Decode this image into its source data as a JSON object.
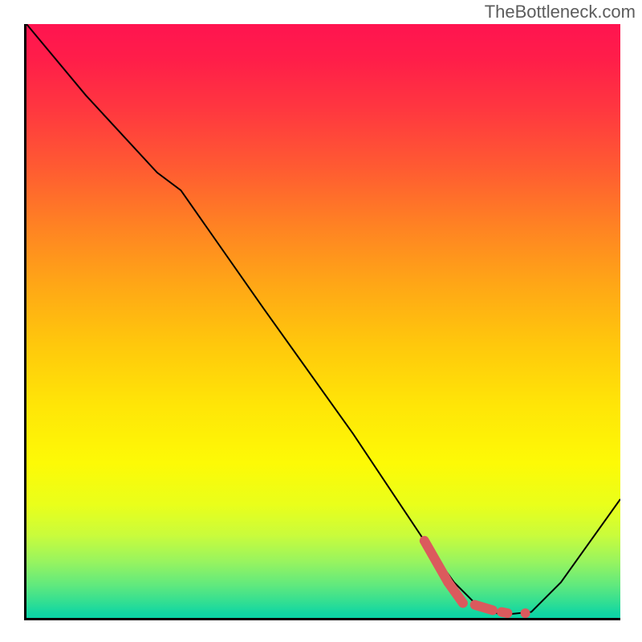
{
  "watermark": "TheBottleneck.com",
  "chart_data": {
    "type": "line",
    "title": "",
    "xlabel": "",
    "ylabel": "",
    "x_range": [
      0,
      100
    ],
    "y_range": [
      0,
      100
    ],
    "axes_visible": {
      "left": true,
      "bottom": true,
      "top": false,
      "right": false
    },
    "tick_labels": false,
    "grid": false,
    "background_gradient": {
      "direction": "vertical",
      "stops": [
        {
          "pos": 0,
          "color": "#ff1450"
        },
        {
          "pos": 0.5,
          "color": "#ffbb10"
        },
        {
          "pos": 0.76,
          "color": "#fdfd05"
        },
        {
          "pos": 1.0,
          "color": "#0ad4a6"
        }
      ],
      "meaning": "red = high bottleneck, green = optimal"
    },
    "series": [
      {
        "name": "bottleneck-curve",
        "color": "#000000",
        "x": [
          0,
          10,
          22,
          26,
          40,
          55,
          67,
          72,
          76,
          80,
          85,
          90,
          100
        ],
        "y": [
          100,
          88,
          75,
          72,
          52,
          31,
          13,
          6,
          2,
          0.5,
          1,
          6,
          20
        ]
      }
    ],
    "highlight": {
      "name": "optimal-range",
      "color": "#db5a5d",
      "style": "thick-dashed-caps",
      "segments": [
        {
          "x": [
            67.0,
            71.0
          ],
          "y": [
            13.0,
            6.0
          ]
        },
        {
          "x": [
            71.0,
            73.5
          ],
          "y": [
            6.0,
            2.5
          ]
        },
        {
          "x": [
            75.5,
            78.5
          ],
          "y": [
            2.2,
            1.3
          ]
        },
        {
          "x": [
            80.0,
            81.0
          ],
          "y": [
            1.0,
            0.8
          ]
        }
      ],
      "dots": [
        {
          "x": 84.0,
          "y": 0.8
        }
      ]
    }
  }
}
